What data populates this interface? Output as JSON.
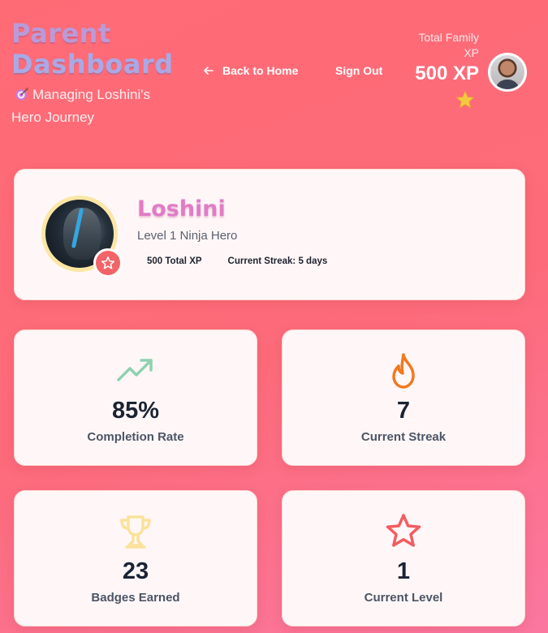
{
  "header": {
    "title_line1": "Parent",
    "title_line2": "Dashboard",
    "subtitle": "Managing Loshini's Hero Journey",
    "back_label": "Back to Home",
    "signout_label": "Sign Out",
    "xp_label": "Total Family XP",
    "xp_value": "500 XP"
  },
  "profile": {
    "name": "Loshini",
    "level": "Level 1 Ninja Hero",
    "total_xp": "500 Total XP",
    "streak": "Current Streak: 5 days"
  },
  "stats": [
    {
      "icon": "trending-up-icon",
      "value": "85%",
      "label": "Completion Rate",
      "color": "#8fd1b0"
    },
    {
      "icon": "flame-icon",
      "value": "7",
      "label": "Current Streak",
      "color": "#f2781f"
    },
    {
      "icon": "trophy-icon",
      "value": "23",
      "label": "Badges Earned",
      "color": "#fbe29a"
    },
    {
      "icon": "star-icon",
      "value": "1",
      "label": "Current Level",
      "color": "#f25c62"
    }
  ],
  "colors": {
    "background_start": "#ff6b75",
    "background_end": "#fb77a0",
    "card": "#fff7f7",
    "name": "#e07cc6",
    "badge": "#f26467"
  }
}
